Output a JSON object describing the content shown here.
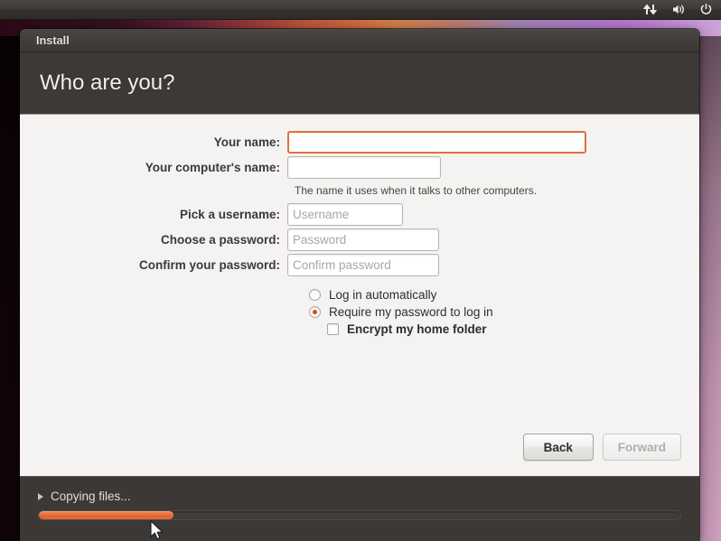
{
  "panel": {
    "icons": [
      {
        "name": "network-icon",
        "glyph": "network"
      },
      {
        "name": "volume-icon",
        "glyph": "volume"
      },
      {
        "name": "power-icon",
        "glyph": "power"
      }
    ]
  },
  "window": {
    "title": "Install",
    "page_title": "Who are you?"
  },
  "form": {
    "fields": [
      {
        "id": "your-name",
        "label": "Your name:",
        "value": "",
        "placeholder": "",
        "width_class": "w-name",
        "focused": true
      },
      {
        "id": "computer-name",
        "label": "Your computer's name:",
        "value": "",
        "placeholder": "",
        "width_class": "w-comp",
        "focused": false
      },
      {
        "id": "username",
        "label": "Pick a username:",
        "value": "",
        "placeholder": "Username",
        "width_class": "w-user",
        "focused": false
      },
      {
        "id": "password",
        "label": "Choose a password:",
        "value": "",
        "placeholder": "Password",
        "width_class": "w-pass",
        "focused": false
      },
      {
        "id": "confirm-password",
        "label": "Confirm your password:",
        "value": "",
        "placeholder": "Confirm password",
        "width_class": "w-pass",
        "focused": false
      }
    ],
    "computer_name_hint": "The name it uses when it talks to other computers.",
    "options": [
      {
        "id": "login-automatically",
        "type": "radio",
        "label": "Log in automatically",
        "checked": false,
        "indent": false,
        "bold": false
      },
      {
        "id": "require-password",
        "type": "radio",
        "label": "Require my password to log in",
        "checked": true,
        "indent": false,
        "bold": false
      },
      {
        "id": "encrypt-home",
        "type": "checkbox",
        "label": "Encrypt my home folder",
        "checked": false,
        "indent": true,
        "bold": true
      }
    ]
  },
  "navigation": {
    "back_label": "Back",
    "forward_label": "Forward",
    "back_enabled": true,
    "forward_enabled": false
  },
  "progress": {
    "label": "Copying files...",
    "percent": 21,
    "expanded": false
  },
  "colors": {
    "accent_orange": "#dd4814",
    "focus_border": "#e2703a",
    "window_chrome": "#3b3836",
    "content_bg": "#f4f3f2"
  }
}
